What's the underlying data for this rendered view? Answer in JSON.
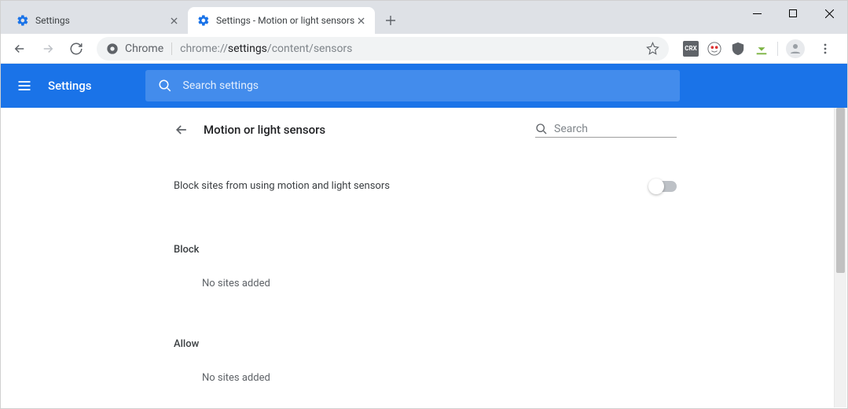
{
  "window": {
    "tabs": [
      {
        "title": "Settings",
        "active": false
      },
      {
        "title": "Settings - Motion or light sensors",
        "active": true
      }
    ]
  },
  "omnibox": {
    "origin_label": "Chrome",
    "url_scheme": "chrome://",
    "url_path_bold": "settings",
    "url_path_rest": "/content/sensors"
  },
  "header": {
    "app_title": "Settings",
    "search_placeholder": "Search settings"
  },
  "page": {
    "title": "Motion or light sensors",
    "search_placeholder": "Search",
    "main_toggle_label": "Block sites from using motion and light sensors",
    "main_toggle_on": false,
    "sections": {
      "block": {
        "title": "Block",
        "empty": "No sites added"
      },
      "allow": {
        "title": "Allow",
        "empty": "No sites added"
      }
    }
  }
}
